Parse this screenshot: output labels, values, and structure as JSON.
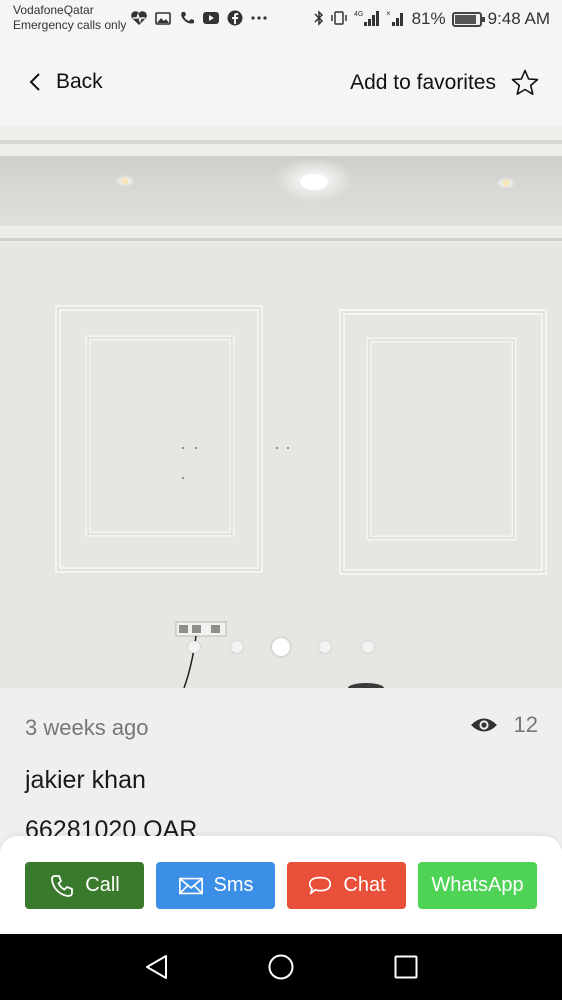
{
  "status_bar": {
    "carrier": "VodafoneQatar",
    "carrier_sub": "Emergency calls only",
    "network": "4G",
    "battery": "81%",
    "time": "9:48 AM",
    "icons_left": [
      "heart-rate-icon",
      "gallery-icon",
      "call-icon",
      "youtube-icon",
      "facebook-icon",
      "more-dots-icon"
    ],
    "icons_right": [
      "bluetooth-icon",
      "vibrate-icon",
      "signal-icon",
      "no-signal-icon",
      "battery-icon"
    ]
  },
  "header": {
    "back_label": "Back",
    "favorite_label": "Add to favorites"
  },
  "carousel": {
    "count": 5,
    "active_index": 2
  },
  "listing": {
    "posted": "3 weeks ago",
    "views": "12",
    "seller": "jakier khan",
    "price": "66281020 QAR"
  },
  "actions": {
    "call": "Call",
    "sms": "Sms",
    "chat": "Chat",
    "whatsapp": "WhatsApp"
  },
  "colors": {
    "call": "#3a7a2c",
    "sms": "#3c8fe6",
    "chat": "#e8503a",
    "whatsapp": "#4ed357"
  }
}
